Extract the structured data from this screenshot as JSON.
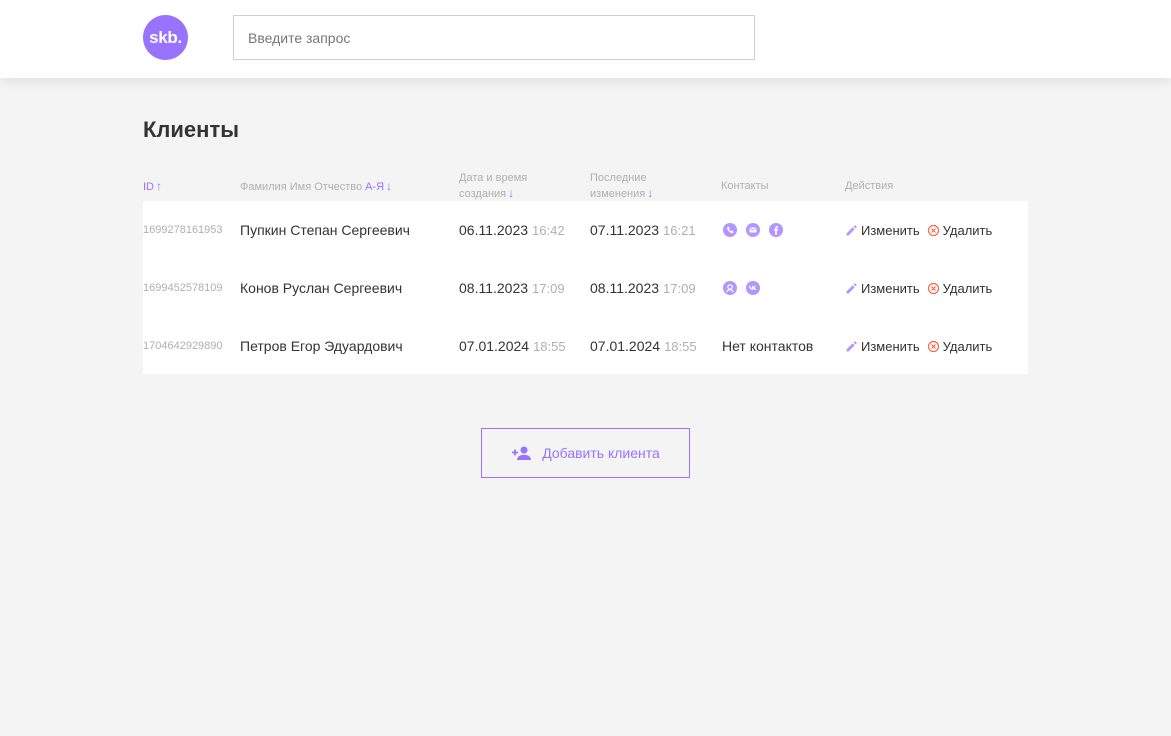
{
  "header": {
    "logo_text": "skb.",
    "search_placeholder": "Введите запрос"
  },
  "page_title": "Клиенты",
  "columns": {
    "id": "ID",
    "name": "Фамилия Имя Отчество",
    "name_sort": "А-Я",
    "created_line1": "Дата и время",
    "created_line2": "создания",
    "changed_line1": "Последние",
    "changed_line2": "изменения",
    "contacts": "Контакты",
    "actions": "Действия"
  },
  "clients": [
    {
      "id": "1699278161953",
      "name": "Пупкин Степан Сергеевич",
      "created_date": "06.11.2023",
      "created_time": "16:42",
      "changed_date": "07.11.2023",
      "changed_time": "16:21",
      "contacts": [
        "phone-icon",
        "email-icon",
        "facebook-icon"
      ]
    },
    {
      "id": "1699452578109",
      "name": "Конов Руслан Сергеевич",
      "created_date": "08.11.2023",
      "created_time": "17:09",
      "changed_date": "08.11.2023",
      "changed_time": "17:09",
      "contacts": [
        "person-icon",
        "vk-icon"
      ]
    },
    {
      "id": "1704642929890",
      "name": "Петров Егор Эдуардович",
      "created_date": "07.01.2024",
      "created_time": "18:55",
      "changed_date": "07.01.2024",
      "changed_time": "18:55",
      "contacts_text": "Нет контактов"
    }
  ],
  "actions": {
    "edit": "Изменить",
    "delete": "Удалить"
  },
  "add_button": "Добавить клиента",
  "colors": {
    "accent": "#9873ff",
    "delete": "#f06a4d",
    "muted": "#b0b0b0"
  }
}
